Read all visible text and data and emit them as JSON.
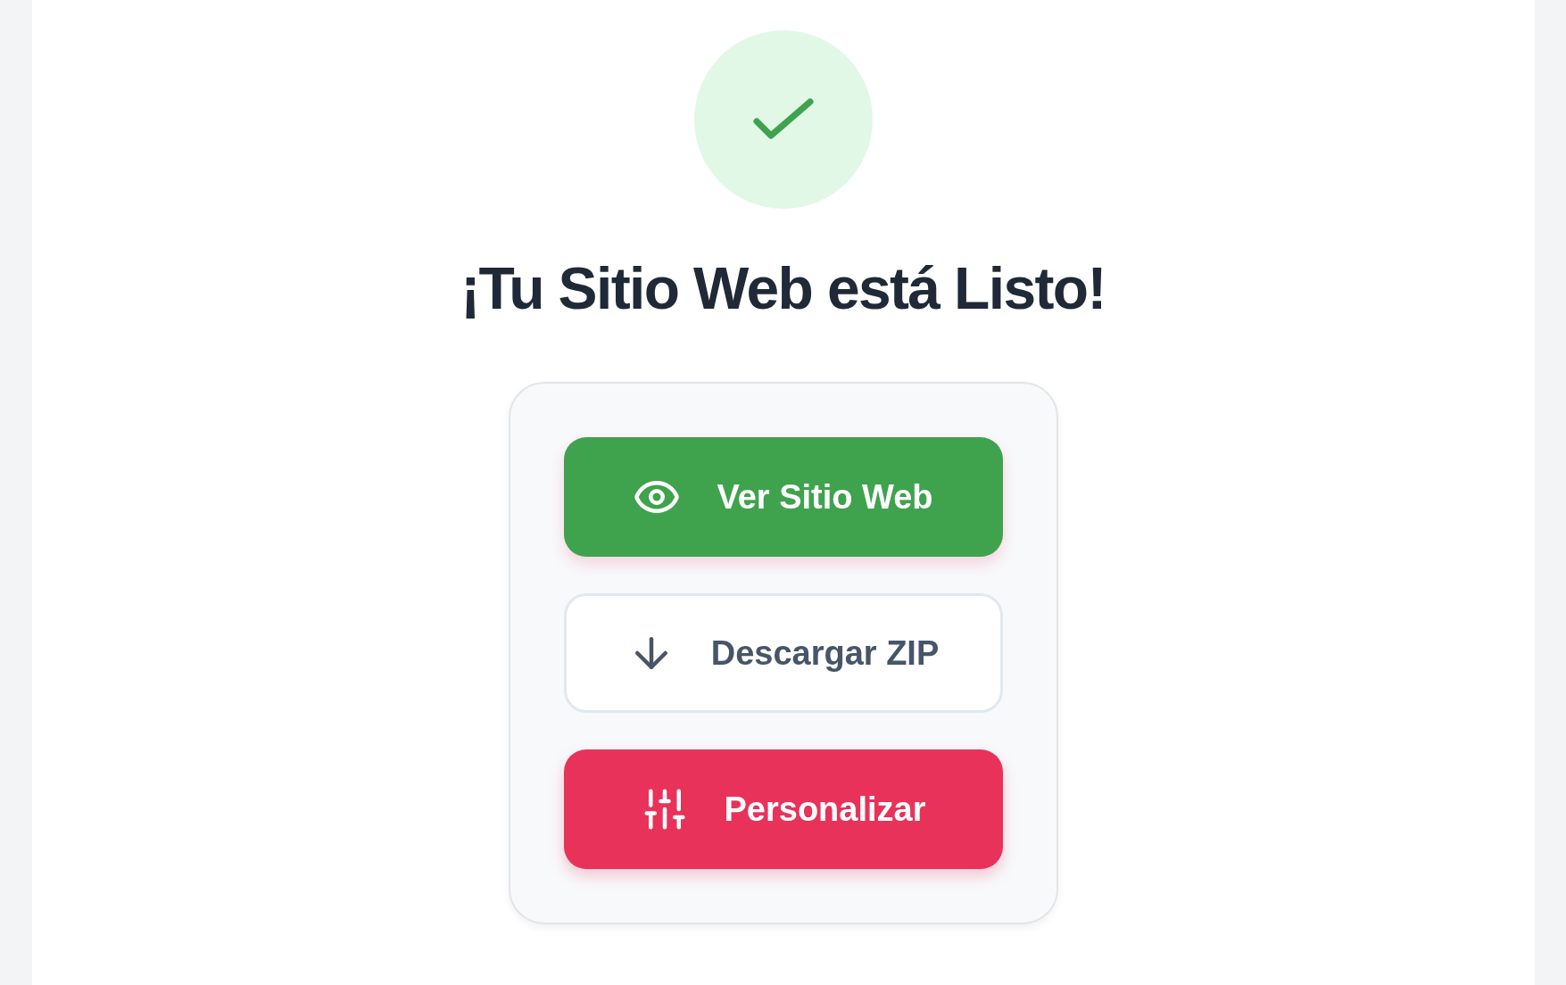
{
  "title": "¡Tu Sitio Web está Listo!",
  "buttons": [
    {
      "kind": "view",
      "label": "Ver Sitio Web"
    },
    {
      "kind": "download",
      "label": "Descargar ZIP"
    },
    {
      "kind": "customize",
      "label": "Personalizar"
    }
  ]
}
